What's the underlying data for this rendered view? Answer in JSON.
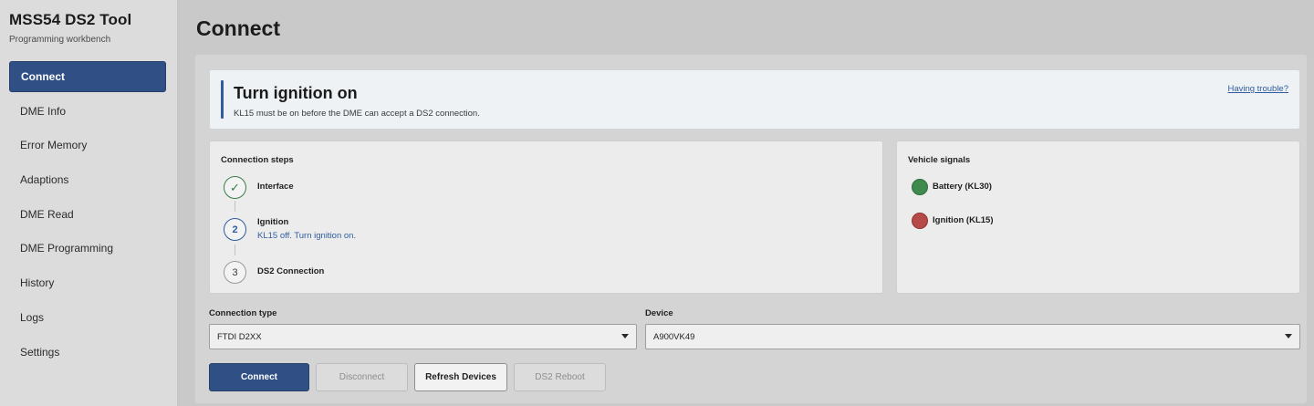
{
  "app": {
    "title": "MSS54 DS2 Tool",
    "subtitle": "Programming workbench"
  },
  "sidebar": {
    "items": [
      {
        "label": "Connect",
        "active": true
      },
      {
        "label": "DME Info"
      },
      {
        "label": "Error Memory"
      },
      {
        "label": "Adaptions"
      },
      {
        "label": "DME Read"
      },
      {
        "label": "DME Programming"
      },
      {
        "label": "History"
      },
      {
        "label": "Logs"
      },
      {
        "label": "Settings"
      }
    ]
  },
  "page": {
    "title": "Connect"
  },
  "alert": {
    "title": "Turn ignition on",
    "text": "KL15 must be on before the DME can accept a DS2 connection.",
    "link": "Having trouble?"
  },
  "steps": {
    "title": "Connection steps",
    "items": [
      {
        "marker": "✓",
        "label": "Interface",
        "state": "done"
      },
      {
        "marker": "2",
        "label": "Ignition",
        "sub": "KL15 off. Turn ignition on.",
        "state": "current"
      },
      {
        "marker": "3",
        "label": "DS2 Connection",
        "state": "pending"
      }
    ]
  },
  "signals": {
    "title": "Vehicle signals",
    "items": [
      {
        "label": "Battery (KL30)",
        "color": "#3f8a4f"
      },
      {
        "label": "Ignition (KL15)",
        "color": "#b54a48"
      }
    ]
  },
  "form": {
    "connection_type_label": "Connection type",
    "connection_type_value": "FTDI D2XX",
    "device_label": "Device",
    "device_value": "A900VK49"
  },
  "buttons": {
    "connect": "Connect",
    "disconnect": "Disconnect",
    "refresh": "Refresh Devices",
    "reboot": "DS2 Reboot"
  },
  "colors": {
    "accent": "#2f4f85",
    "ok": "#3f8a4f",
    "error": "#b54a48"
  }
}
